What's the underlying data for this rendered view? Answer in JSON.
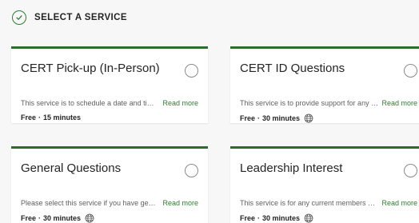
{
  "header": {
    "title": "SELECT A SERVICE",
    "status_icon": "check-circle-icon"
  },
  "colors": {
    "accent": "#2e6b2e",
    "link": "#2e7d32",
    "background": "#f7f7f7"
  },
  "services": [
    {
      "title": "CERT Pick-up (In-Person)",
      "description": "This service is to schedule a date and time t...",
      "read_more": "Read more",
      "price": "Free",
      "separator": "·",
      "duration": "15 minutes",
      "online": false
    },
    {
      "title": "CERT ID Questions",
      "description": "This service is to provide support for any q...",
      "read_more": "Read more",
      "price": "Free",
      "separator": "·",
      "duration": "30 minutes",
      "online": true,
      "online_icon": "globe-icon"
    },
    {
      "title": "General Questions",
      "description": "Please select this service if you have genera...",
      "read_more": "Read more",
      "price": "Free",
      "separator": "·",
      "duration": "30 minutes",
      "online": true,
      "online_icon": "globe-icon"
    },
    {
      "title": "Leadership Interest",
      "description": "This service is for any current members wh...",
      "read_more": "Read more",
      "price": "Free",
      "separator": "·",
      "duration": "30 minutes",
      "online": true,
      "online_icon": "globe-icon"
    }
  ]
}
